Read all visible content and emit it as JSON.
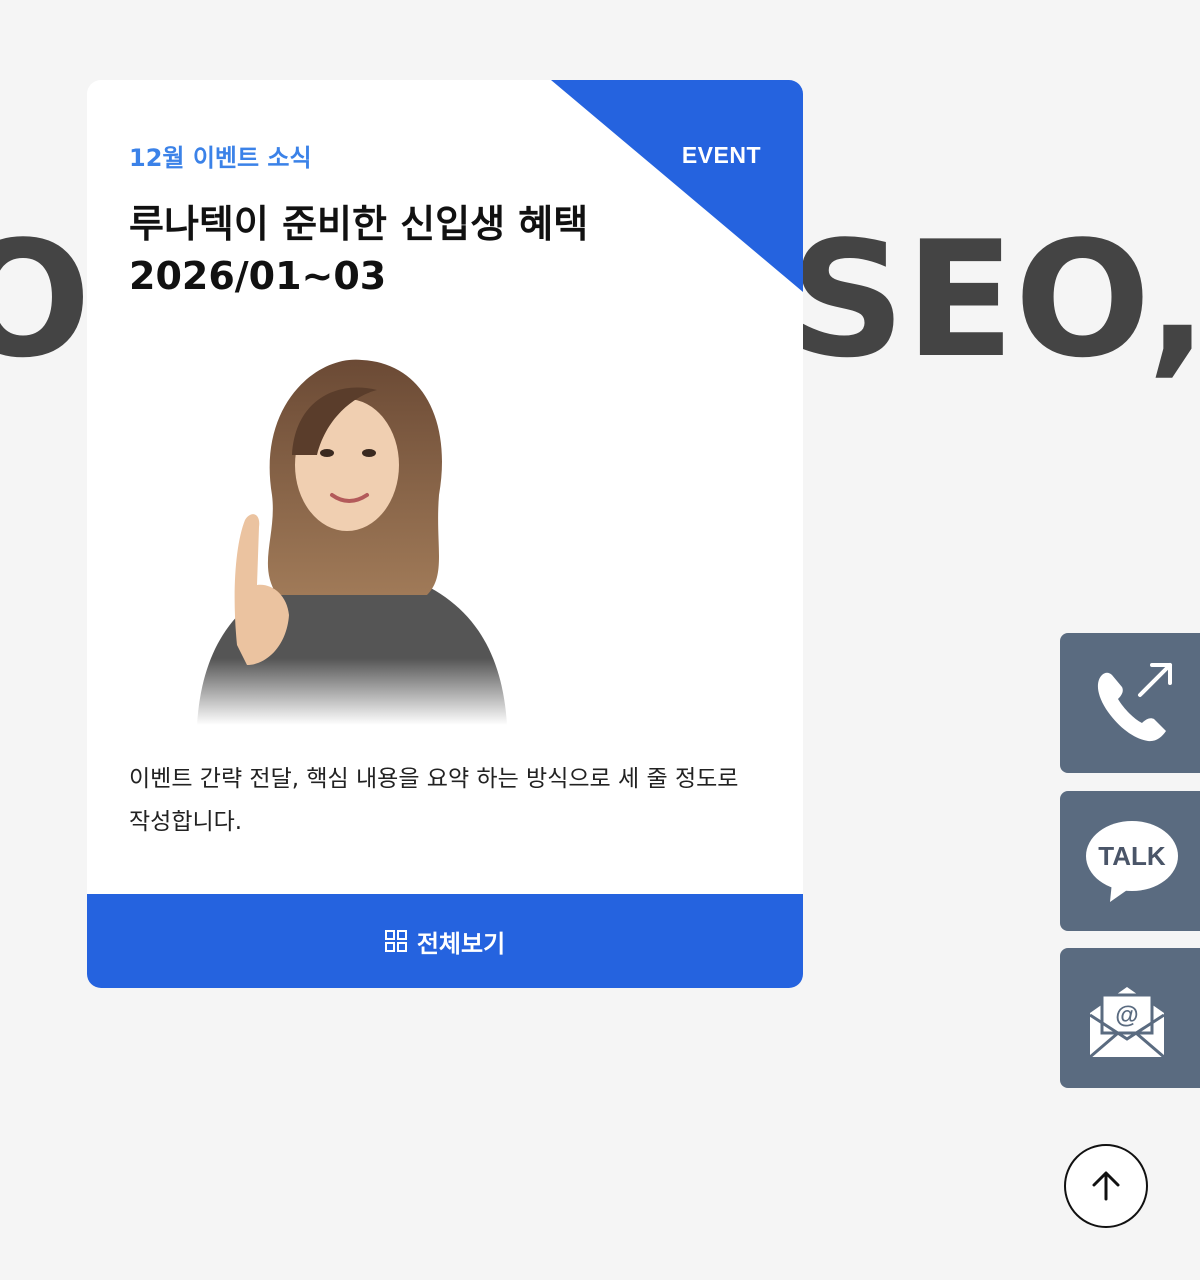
{
  "background": {
    "left_text": "O",
    "right_text": "SEO, W"
  },
  "card": {
    "eyebrow": "12월 이벤트 소식",
    "corner_label": "EVENT",
    "title_line1": "루나텍이 준비한 신입생 혜택",
    "title_line2": "2026/01~03",
    "description": "이벤트 간략 전달, 핵심 내용을 요약 하는 방식으로 세 줄 정도로 작성합니다.",
    "view_all_label": "전체보기",
    "view_all_icon": "grid-icon",
    "photo_subject": "woman pointing up"
  },
  "side_buttons": [
    {
      "name": "phone",
      "icon": "phone-call-icon"
    },
    {
      "name": "talk",
      "icon": "talk-bubble-icon",
      "text": "TALK"
    },
    {
      "name": "mail",
      "icon": "mail-envelope-icon",
      "text": "@"
    }
  ],
  "scroll_top": {
    "icon": "arrow-up-icon"
  },
  "colors": {
    "accent": "#2563df",
    "eyebrow": "#3b82e8",
    "side_button": "#5a6b80",
    "page_bg": "#f5f5f5"
  }
}
